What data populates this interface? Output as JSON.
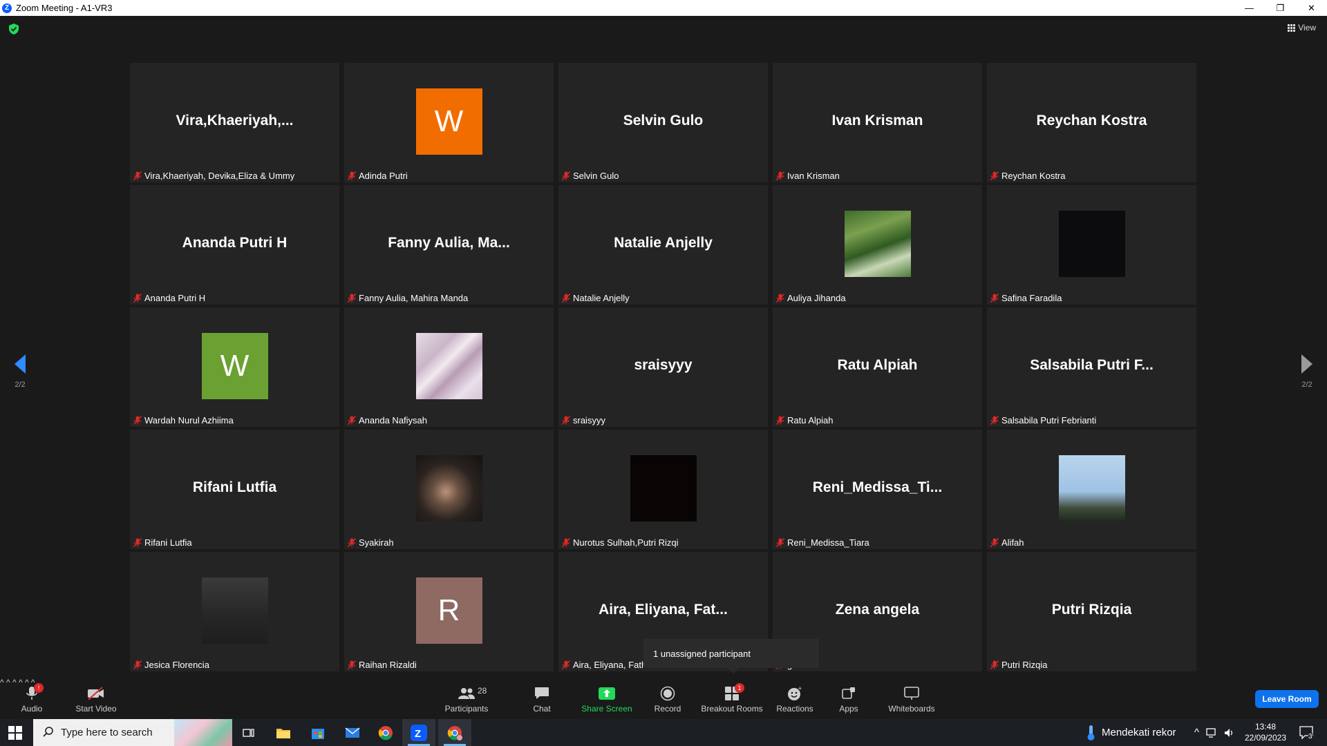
{
  "window": {
    "title": "Zoom Meeting - A1-VR3",
    "minimize": "—",
    "restore": "❐",
    "close": "✕"
  },
  "header": {
    "view_label": "View"
  },
  "pager": {
    "left_label": "2/2",
    "right_label": "2/2"
  },
  "tiles": [
    {
      "display": "Vira,Khaeriyah,...",
      "caption": "Vira,Khaeriyah, Devika,Eliza & Ummy",
      "type": "name"
    },
    {
      "display": "W",
      "caption": "Adinda Putri",
      "type": "letter",
      "color": "#f26d00"
    },
    {
      "display": "Selvin Gulo",
      "caption": "Selvin Gulo",
      "type": "name"
    },
    {
      "display": "Ivan Krisman",
      "caption": "Ivan Krisman",
      "type": "name"
    },
    {
      "display": "Reychan Kostra",
      "caption": "Reychan Kostra",
      "type": "name"
    },
    {
      "display": "Ananda Putri H",
      "caption": "Ananda Putri H",
      "type": "name"
    },
    {
      "display": "Fanny  Aulia,  Ma...",
      "caption": "Fanny Aulia, Mahira Manda",
      "type": "name"
    },
    {
      "display": "Natalie Anjelly",
      "caption": "Natalie Anjelly",
      "type": "name"
    },
    {
      "display": "",
      "caption": "Auliya Jihanda",
      "type": "photo",
      "photo": "jungle"
    },
    {
      "display": "",
      "caption": "Safina Faradila",
      "type": "photo",
      "photo": "stars"
    },
    {
      "display": "W",
      "caption": "Wardah Nurul Azhiima",
      "type": "letter",
      "color": "#6aa132"
    },
    {
      "display": "",
      "caption": "Ananda Nafiysah",
      "type": "photo",
      "photo": "marble"
    },
    {
      "display": "sraisyyy",
      "caption": "sraisyyy",
      "type": "name"
    },
    {
      "display": "Ratu Alpiah",
      "caption": "Ratu Alpiah",
      "type": "name"
    },
    {
      "display": "Salsabila  Putri  F...",
      "caption": "Salsabila Putri Febrianti",
      "type": "name"
    },
    {
      "display": "Rifani Lutfia",
      "caption": "Rifani Lutfia",
      "type": "name"
    },
    {
      "display": "",
      "caption": "Syakirah",
      "type": "photo",
      "photo": "hand"
    },
    {
      "display": "",
      "caption": "Nurotus Sulhah,Putri Rizqi",
      "type": "photo",
      "photo": "black"
    },
    {
      "display": "Reni_Medissa_Ti...",
      "caption": "Reni_Medissa_Tiara",
      "type": "name"
    },
    {
      "display": "",
      "caption": "Alifah",
      "type": "photo",
      "photo": "sky"
    },
    {
      "display": "",
      "caption": "Jesica Florencia",
      "type": "photo",
      "photo": "dark"
    },
    {
      "display": "R",
      "caption": "Raihan Rizaldi",
      "type": "letter",
      "color": "#8e6a63"
    },
    {
      "display": "Aira,  Eliyana,  Fat...",
      "caption": "Aira, Eliyana, Fath",
      "type": "name"
    },
    {
      "display": "Zena angela",
      "caption": "gela",
      "type": "name"
    },
    {
      "display": "Putri Rizqia",
      "caption": "Putri Rizqia",
      "type": "name"
    }
  ],
  "tooltip": {
    "text": "1 unassigned participant"
  },
  "toolbar": {
    "audio_label": "Audio",
    "audio_badge": "!",
    "start_video_label": "Start Video",
    "participants_label": "Participants",
    "participants_count": "28",
    "chat_label": "Chat",
    "share_screen_label": "Share Screen",
    "record_label": "Record",
    "breakout_label": "Breakout Rooms",
    "breakout_badge": "1",
    "reactions_label": "Reactions",
    "apps_label": "Apps",
    "whiteboards_label": "Whiteboards",
    "leave_label": "Leave Room"
  },
  "taskbar": {
    "search_placeholder": "Type here to search",
    "weather_text": "Mendekati rekor",
    "time": "13:48",
    "date": "22/09/2023",
    "notification_count": "3"
  },
  "colors": {
    "accent": "#0e72ed",
    "share_green": "#23d959",
    "mic_off_red": "#e02828"
  }
}
